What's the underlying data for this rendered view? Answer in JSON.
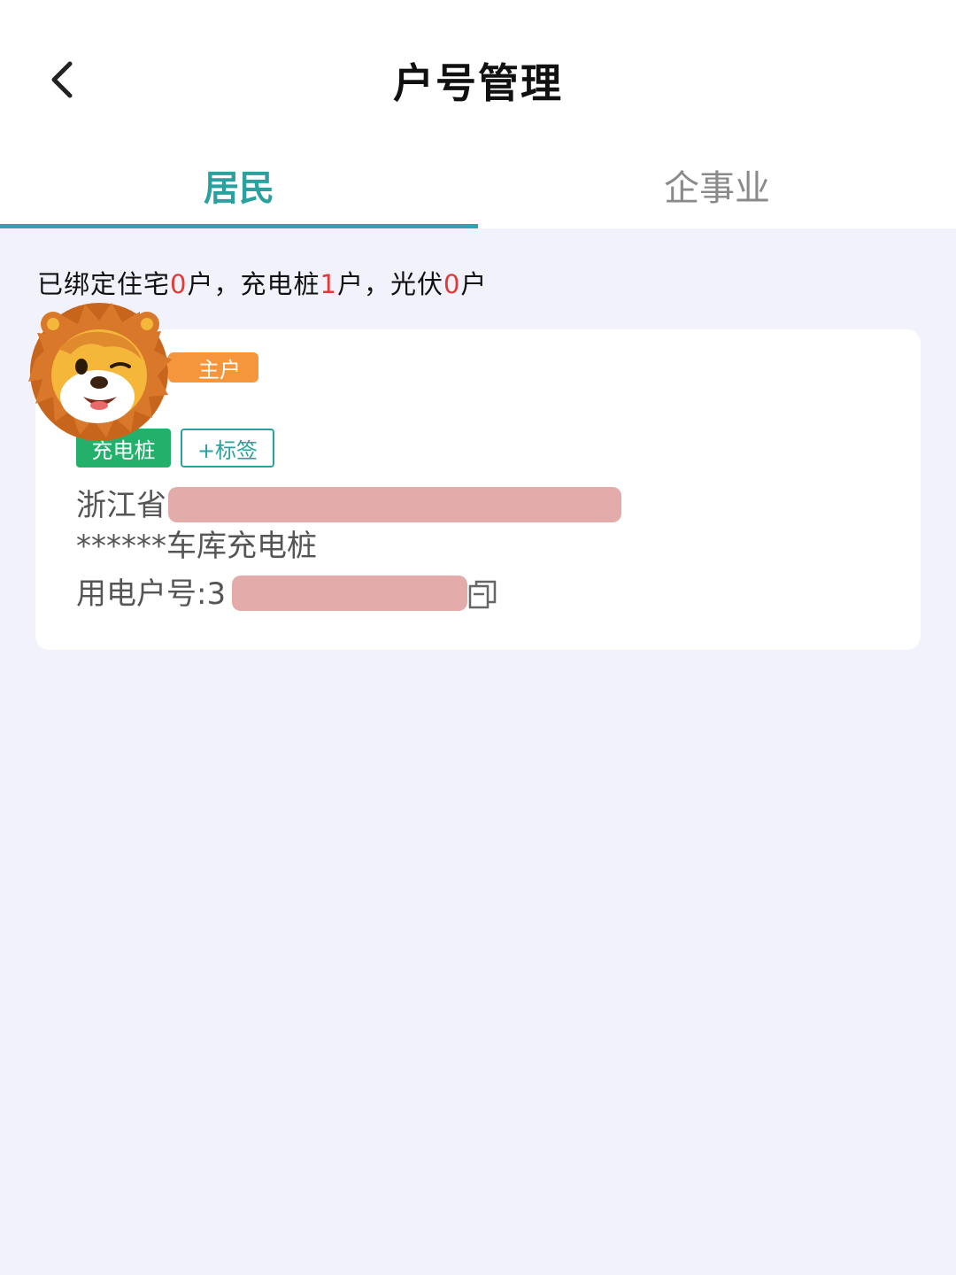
{
  "header": {
    "title": "户号管理",
    "back_icon": "chevron-left-icon"
  },
  "tabs": [
    {
      "label": "居民",
      "active": true
    },
    {
      "label": "企事业",
      "active": false
    }
  ],
  "colors": {
    "accent": "#2aa19e",
    "highlight_number": "#e53935",
    "owner_badge": "#f5963c",
    "type_tag": "#22b06b",
    "background": "#f2f2fc"
  },
  "summary": {
    "prefix": "已绑定住宅",
    "residence_count": "0",
    "residence_unit": "户，充电桩",
    "charger_count": "1",
    "charger_unit": "户，光伏",
    "solar_count": "0",
    "solar_unit": "户"
  },
  "account_card": {
    "owner_badge": "主户",
    "type_tag": "充电桩",
    "add_tag_label": "+标签",
    "address_line1": "浙江省",
    "address_line2": "******车库充电桩",
    "account_label": "用电户号:3",
    "copy_icon": "copy-icon"
  }
}
